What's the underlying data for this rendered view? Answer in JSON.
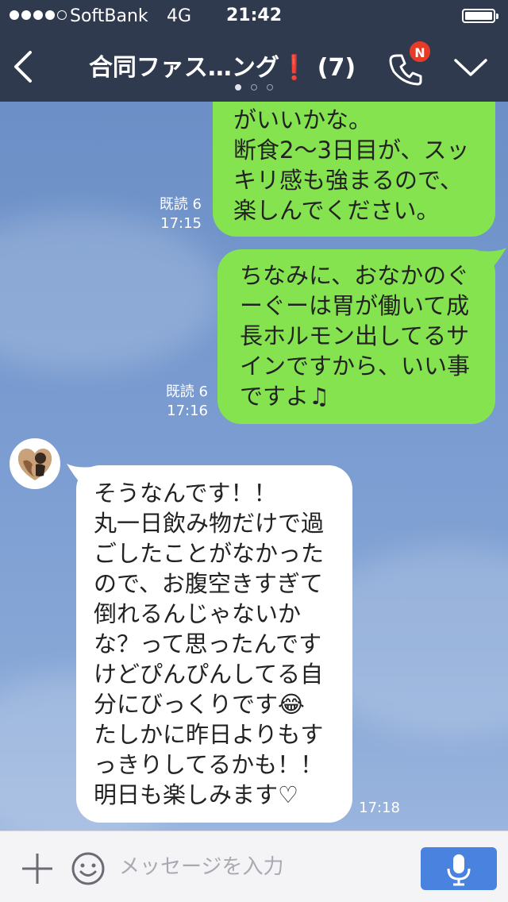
{
  "status_bar": {
    "carrier": "SoftBank",
    "network": "4G",
    "time": "21:42",
    "signal_icon": "signal-dots-icon",
    "battery_icon": "battery-icon",
    "battery_level": 1.0
  },
  "nav": {
    "back_icon": "chevron-left-icon",
    "title": "合同ファス…ング",
    "title_mark": "❗",
    "member_count": "(7)",
    "page_indicator": {
      "pages": 3,
      "active": 1
    },
    "call_icon": "phone-icon",
    "notification_badge": "N",
    "menu_icon": "chevron-down-icon"
  },
  "messages": [
    {
      "sender": "me",
      "text": "がいいかな。\n断食2〜3日目が、スッ\nキリ感も強まるので、\n楽しんでください。",
      "read": "既読 6",
      "time": "17:15"
    },
    {
      "sender": "me",
      "text": "ちなみに、おなかのぐ\nーぐーは胃が働いて成\n長ホルモン出してるサ\nインですから、いい事\nですよ♫",
      "read": "既読 6",
      "time": "17:16"
    },
    {
      "sender": "other",
      "text": "そうなんです！！\n丸一日飲み物だけで過\nごしたことがなかった\nので、お腹空きすぎて\n倒れるんじゃないか\nな？って思ったんです\nけどぴんぴんしてる自\n分にびっくりです😂\nたしかに昨日よりもす\nっきりしてるかも！！\n明日も楽しみます♡",
      "time": "17:18"
    }
  ],
  "input_bar": {
    "plus_icon": "plus-icon",
    "emoji_icon": "smiley-icon",
    "placeholder": "メッセージを入力",
    "value": "",
    "mic_icon": "microphone-icon"
  },
  "colors": {
    "header_bg": "#2f3a4f",
    "my_bubble": "#84e34f",
    "their_bubble": "#ffffff",
    "badge": "#e63c27",
    "mic_button": "#4a82e0"
  }
}
